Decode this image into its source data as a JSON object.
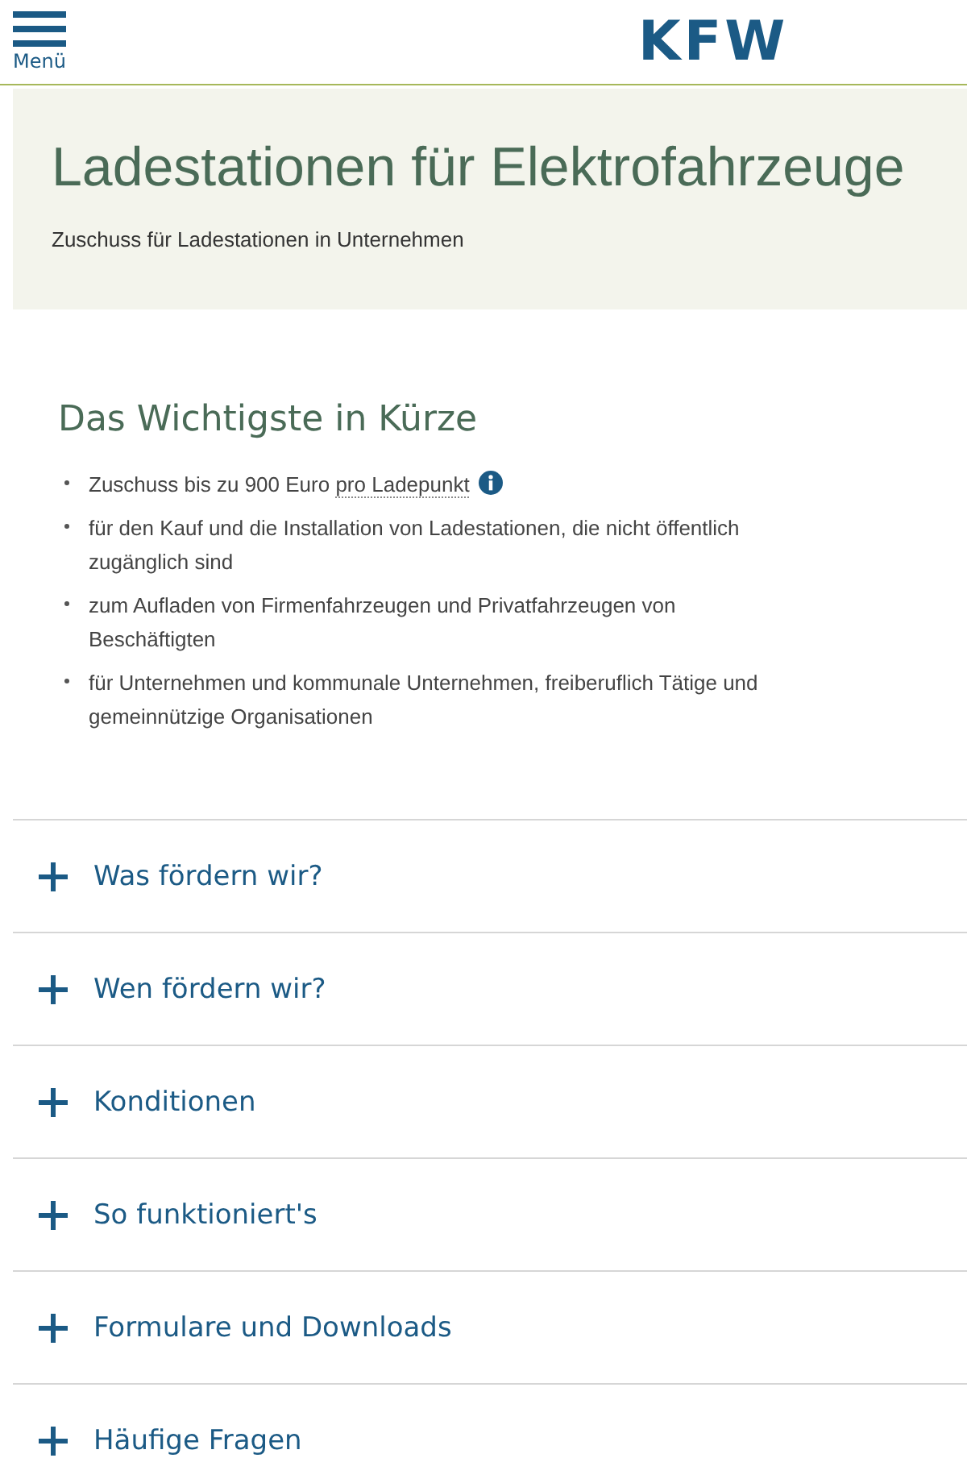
{
  "header": {
    "menu_label": "Menü",
    "logo": "KFW"
  },
  "hero": {
    "title": "Ladestationen für Elektrofahrzeuge",
    "subtitle": "Zuschuss für Ladestationen in Unternehmen"
  },
  "summary": {
    "heading": "Das Wichtigste in Kürze",
    "items": [
      {
        "text": "Zuschuss bis zu 900 Euro ",
        "term": "pro Ladepunkt",
        "info": true
      },
      {
        "text": "für den Kauf und die Installation von Ladestationen, die nicht öffentlich zugänglich sind",
        "info": false
      },
      {
        "text": "zum Aufladen von Firmenfahrzeugen und Privatfahrzeugen von Beschäftigten",
        "info": false
      },
      {
        "text": "für Unternehmen und kommunale Unternehmen, freiberuflich Tätige und gemeinnützige Organisationen",
        "info": false
      }
    ]
  },
  "accordion": [
    {
      "label": "Was fördern wir?",
      "expanded": false
    },
    {
      "label": "Wen fördern wir?",
      "expanded": false
    },
    {
      "label": "Konditionen",
      "expanded": false
    },
    {
      "label": "So funktioniert's",
      "expanded": false
    },
    {
      "label": "Formulare und Downloads",
      "expanded": false
    },
    {
      "label": "Häufige Fragen",
      "expanded": false
    }
  ]
}
